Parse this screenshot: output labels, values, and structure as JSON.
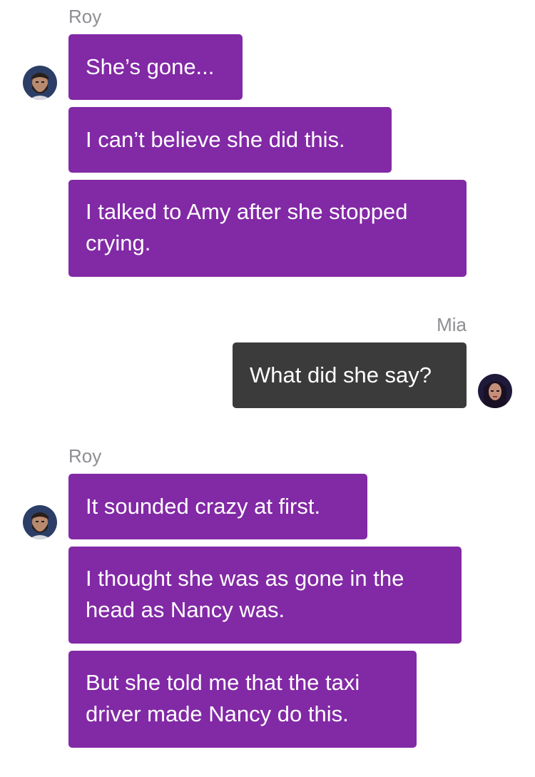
{
  "messages": [
    {
      "sender": "Roy",
      "side": "left",
      "bubbles": [
        "She’s gone...",
        "I can’t believe she did this.",
        "I talked to Amy after she stopped crying."
      ],
      "avatar_icon": "bearded-man-avatar-icon"
    },
    {
      "sender": "Mia",
      "side": "right",
      "bubbles": [
        "What did she say?"
      ],
      "avatar_icon": "woman-avatar-icon"
    },
    {
      "sender": "Roy",
      "side": "left",
      "bubbles": [
        "It sounded crazy at first.",
        "I thought she was as gone in the head as Nancy was.",
        "But she told me that the taxi driver made Nancy do this."
      ],
      "avatar_icon": "bearded-man-avatar-icon"
    }
  ],
  "colors": {
    "roy_bubble": "#8229a6",
    "mia_bubble": "#3b3b3b",
    "sender_text": "#8e8e93",
    "background": "#ffffff"
  }
}
